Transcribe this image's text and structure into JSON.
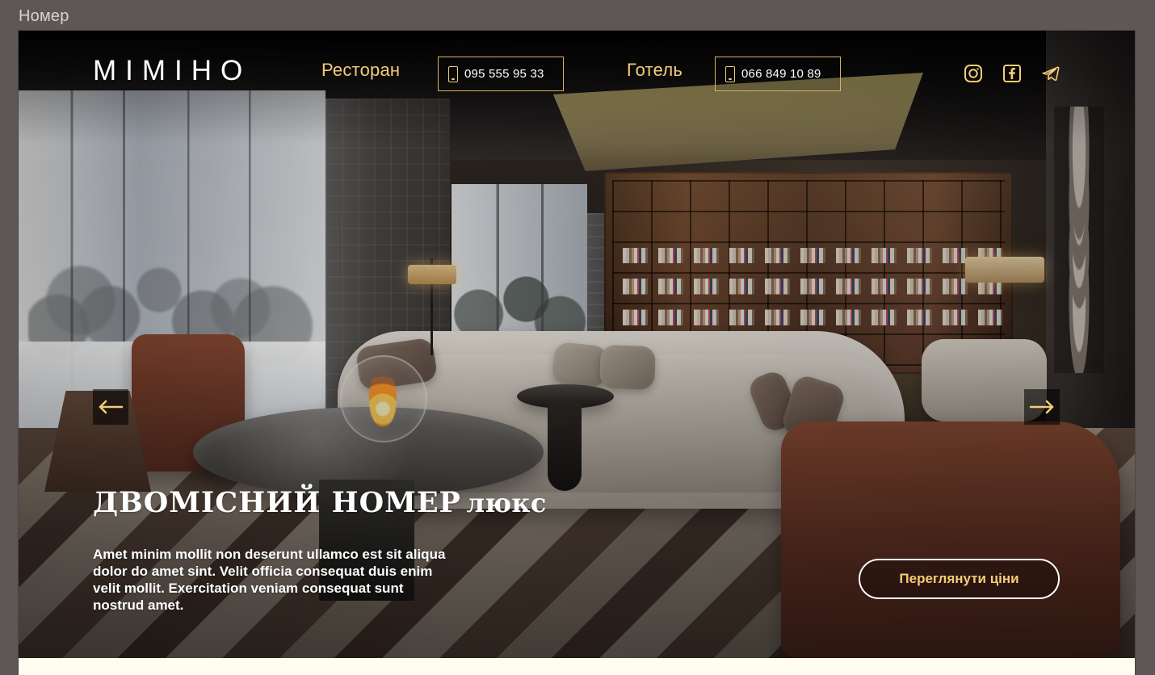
{
  "page": {
    "frame_label": "Номер"
  },
  "header": {
    "brand": "ΜΙΜΙΗΟ",
    "restaurant_label": "Ресторан",
    "restaurant_phone": "095 555 95 33",
    "hotel_label": "Готель",
    "hotel_phone": "066 849 10 89"
  },
  "icons": {
    "phone": "phone-icon",
    "instagram": "instagram-icon",
    "facebook": "facebook-icon",
    "telegram": "telegram-icon",
    "left_arrow": "left-arrow-icon",
    "right_arrow": "right-arrow-icon"
  },
  "hero": {
    "title_main": "ДВОМІСНИЙ НОМЕР",
    "title_suffix": "люкс",
    "description": "Amet minim mollit non deserunt ullamco est sit aliqua dolor do amet sint. Velit officia consequat duis enim velit mollit. Exercitation veniam consequat sunt nostrud amet.",
    "cta_label": "Переглянути ціни"
  },
  "colors": {
    "accent": "#f4cc78",
    "text_light": "#ffffff",
    "border_accent": "#d8b462",
    "background_outer": "#5d5857",
    "bottom_strip": "#fffdf0"
  }
}
